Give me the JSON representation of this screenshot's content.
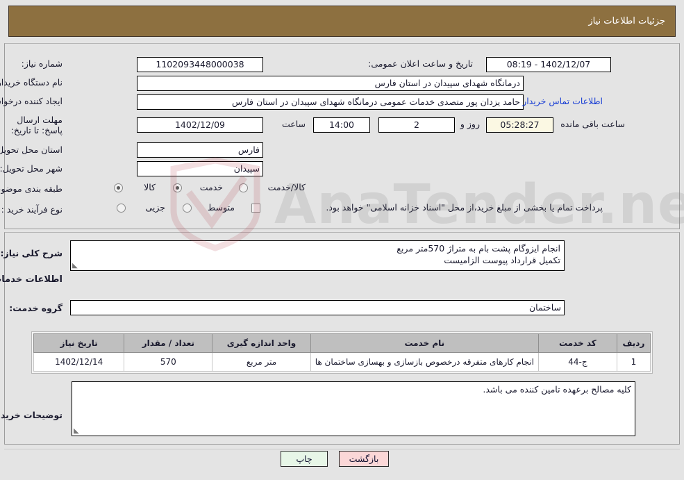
{
  "header": {
    "title": "جزئیات اطلاعات نیاز"
  },
  "form": {
    "need_number_label": "شماره نیاز:",
    "need_number_value": "1102093448000038",
    "public_announce_label": "تاریخ و ساعت اعلان عمومی:",
    "public_announce_value": "1402/12/07 - 08:19",
    "buyer_org_label": "نام دستگاه خریدار:",
    "buyer_org_value": "درمانگاه شهدای سپیدان در استان فارس",
    "creator_label": "ایجاد کننده درخواست:",
    "creator_value": "حامد یزدان پور متصدی خدمات عمومی درمانگاه شهدای سپیدان در استان فارس",
    "buyer_contact_link": "اطلاعات تماس خریدار",
    "deadline_label": "مهلت ارسال پاسخ: تا تاریخ:",
    "deadline_date": "1402/12/09",
    "deadline_hour_label": "ساعت",
    "deadline_hour_value": "14:00",
    "remaining_days_value": "2",
    "remaining_days_label": "روز و",
    "remaining_time_value": "05:28:27",
    "remaining_time_label": "ساعت باقی مانده",
    "province_label": "استان محل تحویل:",
    "province_value": "فارس",
    "city_label": "شهر محل تحویل:",
    "city_value": "سپیدان",
    "category_label": "طبقه بندی موضوعی:",
    "category_options": [
      {
        "label": "کالا",
        "selected": false
      },
      {
        "label": "خدمت",
        "selected": true
      },
      {
        "label": "کالا/خدمت",
        "selected": false
      }
    ],
    "process_label": "نوع فرآیند خرید :",
    "process_options": [
      {
        "label": "جزیی",
        "selected": false
      },
      {
        "label": "متوسط",
        "selected": false
      }
    ],
    "treasury_checkbox_checked": false,
    "treasury_note": "پرداخت تمام یا بخشی از مبلغ خرید،از محل \"اسناد خزانه اسلامی\" خواهد بود."
  },
  "details": {
    "summary_label": "شرح کلی نیاز:",
    "summary_line1": "انجام ایزوگام پشت بام به متراژ 570متر مربع",
    "summary_line2": "تکمیل قرارداد پیوست الزامیست",
    "services_heading": "اطلاعات خدمات مورد نیاز",
    "service_group_label": "گروه خدمت:",
    "service_group_value": "ساختمان",
    "buyer_notes_label": "توضیحات خریدار:",
    "buyer_notes_value": "کلیه مصالح برعهده تامین کننده می باشد."
  },
  "table": {
    "columns": [
      "ردیف",
      "کد خدمت",
      "نام خدمت",
      "واحد اندازه گیری",
      "تعداد / مقدار",
      "تاریخ نیاز"
    ],
    "rows": [
      {
        "row": "1",
        "code": "ج-44",
        "name": "انجام کارهای متفرقه درخصوص بازسازی و بهسازی ساختمان ها",
        "unit": "متر مربع",
        "quantity": "570",
        "date": "1402/12/14"
      }
    ]
  },
  "footer": {
    "print_label": "چاپ",
    "back_label": "بازگشت"
  },
  "watermark": {
    "text": "AnaTender.net"
  },
  "colors": {
    "header_brown": "#8d7040",
    "link_blue": "#1a3fd4",
    "print_green": "#e7f6e7",
    "back_pink": "#fbd7d7",
    "countdown_cream": "#fbf8e3"
  }
}
